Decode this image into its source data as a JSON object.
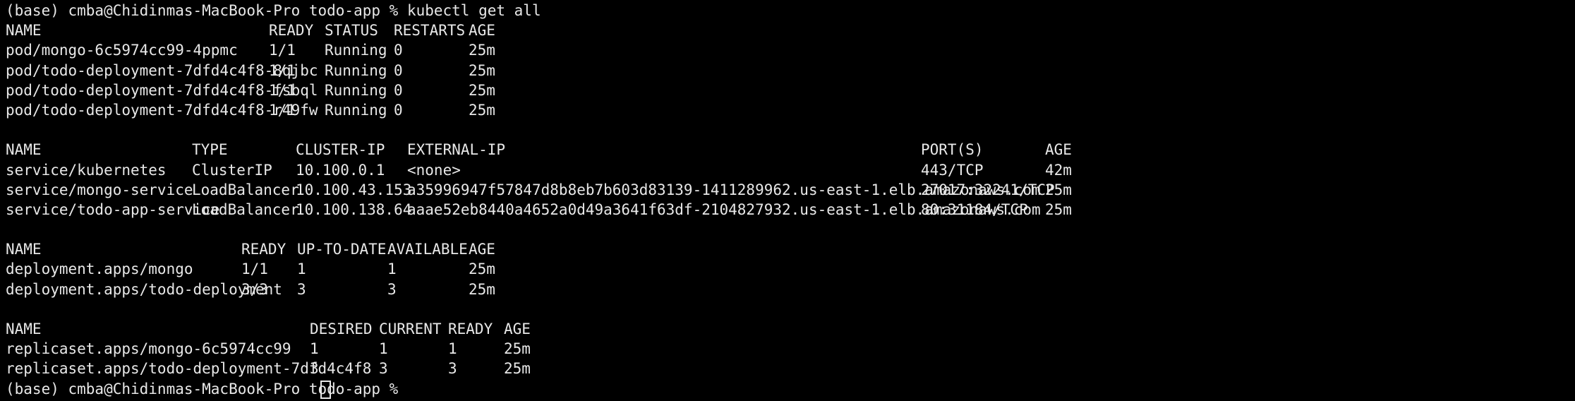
{
  "terminal": {
    "prompt": "(base) cmba@Chidinmas-MacBook-Pro todo-app % kubectl get all",
    "prompt_next": "(base) cmba@Chidinmas-MacBook-Pro todo-app % "
  },
  "pods": {
    "headers": [
      "NAME",
      "READY",
      "STATUS",
      "RESTARTS",
      "AGE"
    ],
    "rows": [
      [
        "pod/mongo-6c5974cc99-4ppmc",
        "1/1",
        "Running",
        "0",
        "25m"
      ],
      [
        "pod/todo-deployment-7dfd4c4f8-8qjbc",
        "1/1",
        "Running",
        "0",
        "25m"
      ],
      [
        "pod/todo-deployment-7dfd4c4f8-fsbql",
        "1/1",
        "Running",
        "0",
        "25m"
      ],
      [
        "pod/todo-deployment-7dfd4c4f8-r49fw",
        "1/1",
        "Running",
        "0",
        "25m"
      ]
    ]
  },
  "services": {
    "headers": [
      "NAME",
      "TYPE",
      "CLUSTER-IP",
      "EXTERNAL-IP",
      "PORT(S)",
      "AGE"
    ],
    "rows": [
      [
        "service/kubernetes",
        "ClusterIP",
        "10.100.0.1",
        "<none>",
        "443/TCP",
        "42m"
      ],
      [
        "service/mongo-service",
        "LoadBalancer",
        "10.100.43.153",
        "a35996947f57847d8b8eb7b603d83139-1411289962.us-east-1.elb.amazonaws.com",
        "27017:32241/TCP",
        "25m"
      ],
      [
        "service/todo-app-service",
        "LoadBalancer",
        "10.100.138.64",
        "aaae52eb8440a4652a0d49a3641f63df-2104827932.us-east-1.elb.amazonaws.com",
        "80:31184/TCP",
        "25m"
      ]
    ]
  },
  "deployments": {
    "headers": [
      "NAME",
      "READY",
      "UP-TO-DATE",
      "AVAILABLE",
      "AGE"
    ],
    "rows": [
      [
        "deployment.apps/mongo",
        "1/1",
        "1",
        "1",
        "25m"
      ],
      [
        "deployment.apps/todo-deployment",
        "3/3",
        "3",
        "3",
        "25m"
      ]
    ]
  },
  "replicasets": {
    "headers": [
      "NAME",
      "DESIRED",
      "CURRENT",
      "READY",
      "AGE"
    ],
    "rows": [
      [
        "replicaset.apps/mongo-6c5974cc99",
        "1",
        "1",
        "1",
        "25m"
      ],
      [
        "replicaset.apps/todo-deployment-7dfd4c4f8",
        "3",
        "3",
        "3",
        "25m"
      ]
    ]
  }
}
